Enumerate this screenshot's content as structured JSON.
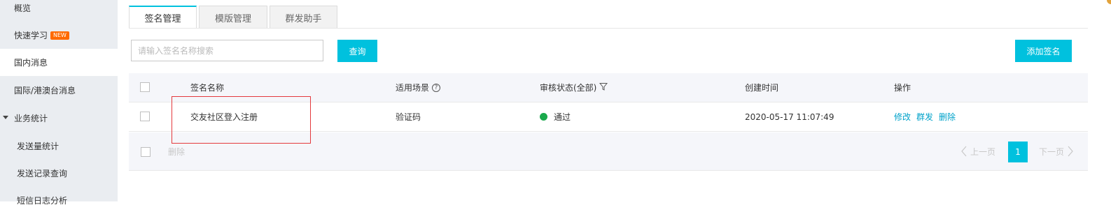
{
  "sidebar": {
    "items": [
      {
        "label": "概览"
      },
      {
        "label": "快速学习",
        "badge": "NEW"
      },
      {
        "label": "国内消息"
      },
      {
        "label": "国际/港澳台消息"
      },
      {
        "label": "业务统计"
      },
      {
        "label": "发送量统计"
      },
      {
        "label": "发送记录查询"
      },
      {
        "label": "短信日志分析"
      }
    ]
  },
  "tabs": [
    {
      "label": "签名管理"
    },
    {
      "label": "模版管理"
    },
    {
      "label": "群发助手"
    }
  ],
  "search": {
    "placeholder": "请输入签名名称搜索",
    "value": "",
    "query_label": "查询"
  },
  "add_button_label": "添加签名",
  "table": {
    "headers": {
      "name": "签名名称",
      "scene": "适用场景",
      "status": "审核状态(全部)",
      "created": "创建时间",
      "actions": "操作"
    },
    "rows": [
      {
        "name": "交友社区登入注册",
        "scene": "验证码",
        "status": "通过",
        "status_color": "#1aa94c",
        "created": "2020-05-17 11:07:49",
        "actions": [
          "修改",
          "群发",
          "删除"
        ]
      }
    ],
    "footer": {
      "delete_label": "删除",
      "prev_label": "上一页",
      "next_label": "下一页",
      "current_page": "1"
    }
  },
  "colors": {
    "accent": "#00c1de",
    "link": "#00a2ca",
    "success": "#1aa94c",
    "highlight": "#e4393c"
  }
}
